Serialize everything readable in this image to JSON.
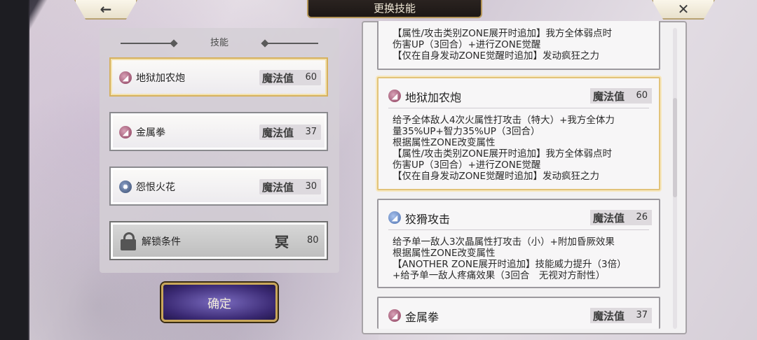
{
  "header": {
    "title": "更换技能",
    "back_glyph": "←",
    "close_glyph": "✕"
  },
  "left_panel": {
    "title": "技能",
    "slots": [
      {
        "name": "地狱加农炮",
        "mp_label": "魔法值",
        "mp_value": "60",
        "selected": true
      },
      {
        "name": "金属拳",
        "mp_label": "魔法值",
        "mp_value": "37",
        "selected": false
      },
      {
        "name": "怨恨火花",
        "mp_label": "魔法值",
        "mp_value": "30",
        "selected": false
      }
    ],
    "locked_slot": {
      "label": "解锁条件",
      "glyph": "冥",
      "value": "80"
    },
    "confirm_label": "确定"
  },
  "detail_list": {
    "partial_card": {
      "lines": [
        "【属性/攻击类别ZONE展开时追加】我方全体弱点时",
        "伤害UP（3回合）+进行ZONE觉醒",
        "【仅在自身发动ZONE觉醒时追加】发动疯狂之力"
      ]
    },
    "cards": [
      {
        "name": "地狱加农炮",
        "mp_label": "魔法值",
        "mp_value": "60",
        "lines": [
          "给予全体敌人4次火属性打攻击（特大）+我方全体力",
          "量35%UP+智力35%UP（3回合）",
          "根据属性ZONE改变属性",
          "【属性/攻击类别ZONE展开时追加】我方全体弱点时",
          "伤害UP（3回合）+进行ZONE觉醒",
          "【仅在自身发动ZONE觉醒时追加】发动疯狂之力"
        ]
      },
      {
        "name": "狡猾攻击",
        "mp_label": "魔法值",
        "mp_value": "26",
        "lines": [
          "给予单一敌人3次晶属性打攻击（小）+附加昏厥效果",
          "根据属性ZONE改变属性",
          "【ANOTHER ZONE展开时追加】技能威力提升（3倍）",
          "+给予单一敌人疼痛效果（3回合　无视对方耐性）"
        ]
      },
      {
        "name": "金属拳",
        "mp_label": "魔法值",
        "mp_value": "37",
        "lines": []
      }
    ]
  }
}
